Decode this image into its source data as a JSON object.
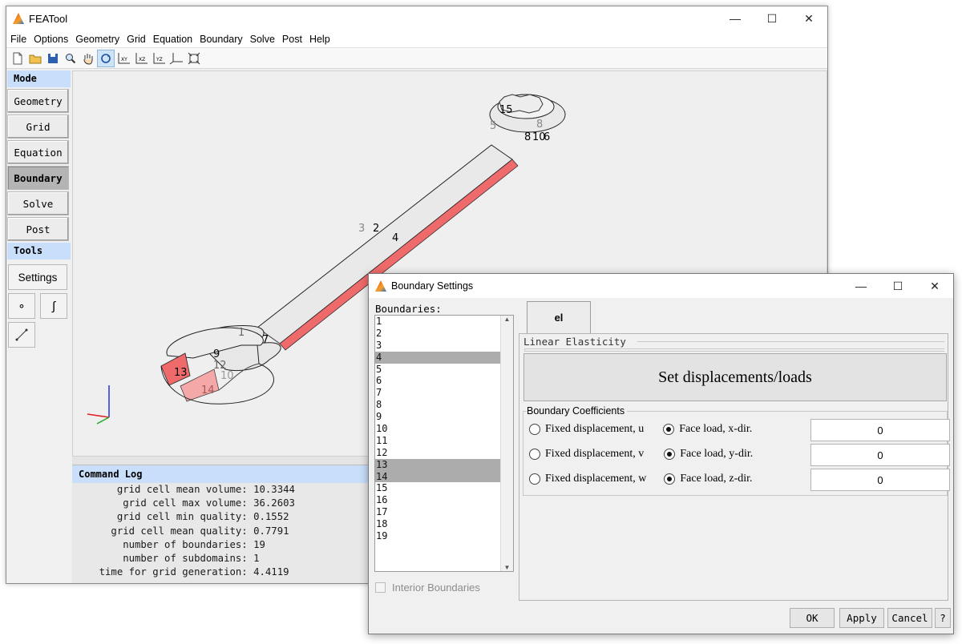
{
  "main": {
    "title": "FEATool",
    "window_buttons": {
      "minimize": "—",
      "maximize": "☐",
      "close": "✕"
    },
    "menu": [
      "File",
      "Options",
      "Geometry",
      "Grid",
      "Equation",
      "Boundary",
      "Solve",
      "Post",
      "Help"
    ],
    "toolbar_icons": [
      "new-file-icon",
      "open-folder-icon",
      "save-icon",
      "zoom-icon",
      "pan-hand-icon",
      "rotate-icon",
      "axes-xy-icon",
      "axes-xz-icon",
      "axes-yz-icon",
      "axes-3d-icon",
      "fit-view-icon"
    ],
    "mode_header": "Mode",
    "modes": [
      "Geometry",
      "Grid",
      "Equation",
      "Boundary",
      "Solve",
      "Post"
    ],
    "active_mode": "Boundary",
    "tools_header": "Tools",
    "settings_label": "Settings",
    "tool_symbols": [
      "∘",
      "∫"
    ],
    "command_log": {
      "title": "Command Log",
      "lines": [
        "       grid cell mean volume: 10.3344",
        "        grid cell max volume: 36.2603",
        "       grid cell min quality: 0.1552",
        "      grid cell mean quality: 0.7791",
        "        number of boundaries: 19",
        "        number of subdomains: 1",
        "    time for grid generation: 4.4119"
      ]
    },
    "plot_labels": [
      "15",
      "5",
      "8",
      "8",
      "10",
      "6",
      "3",
      "2",
      "4",
      "7",
      "9",
      "12",
      "13",
      "10",
      "14",
      "1"
    ],
    "colors": {
      "selected_boundary": "#f07070",
      "highlight_boundary": "#f4a8a8"
    }
  },
  "dialog": {
    "title": "Boundary Settings",
    "window_buttons": {
      "minimize": "—",
      "maximize": "☐",
      "close": "✕"
    },
    "boundaries_label": "Boundaries:",
    "boundaries": [
      "1",
      "2",
      "3",
      "4",
      "5",
      "6",
      "7",
      "8",
      "9",
      "10",
      "11",
      "12",
      "13",
      "14",
      "15",
      "16",
      "17",
      "18",
      "19"
    ],
    "selected": [
      "4",
      "13",
      "14"
    ],
    "interior_label": "Interior Boundaries",
    "tab_label": "el",
    "physics_label": "Linear Elasticity",
    "set_button": "Set displacements/loads",
    "coeff_label": "Boundary Coefficients",
    "rows": [
      {
        "fixed": "Fixed displacement, u",
        "load": "Face load, x-dir.",
        "value": "0"
      },
      {
        "fixed": "Fixed displacement, v",
        "load": "Face load, y-dir.",
        "value": "0"
      },
      {
        "fixed": "Fixed displacement, w",
        "load": "Face load, z-dir.",
        "value": "0"
      }
    ],
    "buttons": {
      "ok": "OK",
      "apply": "Apply",
      "cancel": "Cancel",
      "help": "?"
    }
  }
}
